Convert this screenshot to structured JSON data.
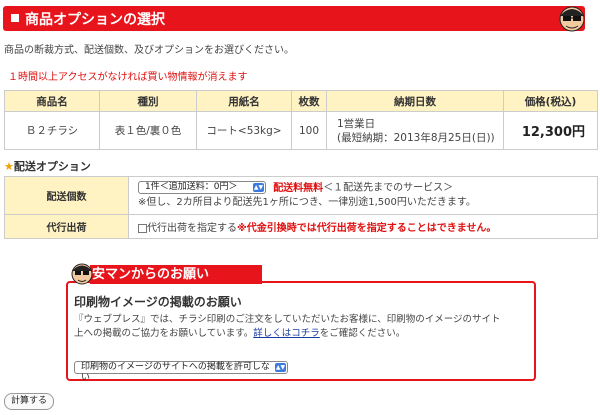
{
  "header": {
    "title": "商品オプションの選択"
  },
  "intro": "商品の断裁方式、配送個数、及びオプションをお選びください。",
  "warning": "１時間以上アクセスがなければ買い物情報が消えます",
  "order_table": {
    "headers": [
      "商品名",
      "種別",
      "用紙名",
      "枚数",
      "納期日数",
      "価格(税込)"
    ],
    "row": {
      "product": "Ｂ２チラシ",
      "type": "表１色/裏０色",
      "paper": "コート<53kg>",
      "quantity": "100",
      "delivery_line1": "1営業日",
      "delivery_line2": "(最短納期：2013年8月25日(日))",
      "price": "12,300円"
    }
  },
  "delivery": {
    "section_title": "配送オプション",
    "count_label": "配送個数",
    "count_select_value": "1件＜追加送料：0円＞",
    "free_shipping": "配送料無料",
    "free_shipping_note": "＜１配送先までのサービス＞",
    "extra_note": "※但し、2カ所目より配送先1ヶ所につき、一律別途1,500円いただきます。",
    "proxy_label": "代行出荷",
    "proxy_checkbox_label": "代行出荷を指定する",
    "proxy_warning": "※代金引換時では代行出荷を指定することはできません。"
  },
  "notice": {
    "banner": "安マンからのお願い",
    "heading": "印刷物イメージの掲載のお願い",
    "body_line1": "『ウェブプレス』では、チラシ印刷のご注文をしていただいたお客様に、印刷物のイメージのサイト",
    "body_line2_prefix": "上への掲載のご協力をお願いしています。",
    "link_text": "詳しくはコチラ",
    "body_line2_suffix": "をご確認ください。",
    "select_value": "印刷物のイメージのサイトへの掲載を許可しない"
  },
  "calc_button": "計算する",
  "colors": {
    "accent_red": "#e8141b",
    "table_header_bg": "#fff3c4",
    "select_arrow": "#3a79e0"
  }
}
